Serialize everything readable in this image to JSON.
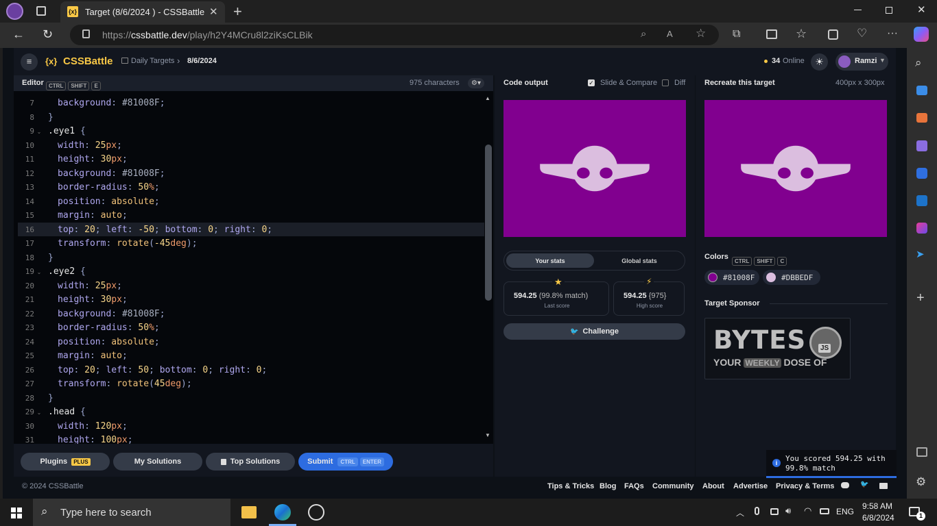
{
  "browser": {
    "tab_title": "Target (8/6/2024 ) - CSSBattle",
    "url_prefix": "https://",
    "url_domain": "cssbattle.dev",
    "url_path": "/play/h2Y4MCru8l2ziKsCLBik"
  },
  "app": {
    "brand": "CSSBattle",
    "brand_glyph": "{x}",
    "breadcrumb_parent": "Daily Targets",
    "breadcrumb_current": "8/6/2024",
    "online": "34",
    "online_label": "Online",
    "user": "Ramzi"
  },
  "editor": {
    "title": "Editor",
    "shortcut": [
      "CTRL",
      "SHIFT",
      "E"
    ],
    "characters": "975 characters",
    "lines": [
      {
        "n": "7",
        "indent": 2,
        "tokens": [
          [
            "prop",
            "background"
          ],
          [
            "plain",
            ": "
          ],
          [
            "hex",
            "#81008F"
          ],
          [
            "plain",
            ";"
          ]
        ]
      },
      {
        "n": "8",
        "indent": 1,
        "tokens": [
          [
            "plain",
            "}"
          ]
        ]
      },
      {
        "n": "9",
        "indent": 1,
        "fold": true,
        "tokens": [
          [
            "sel",
            ".eye1 "
          ],
          [
            "plain",
            "{"
          ]
        ]
      },
      {
        "n": "10",
        "indent": 2,
        "tokens": [
          [
            "prop",
            "width"
          ],
          [
            "plain",
            ": "
          ],
          [
            "num",
            "25"
          ],
          [
            "unit",
            "px"
          ],
          [
            "plain",
            ";"
          ]
        ]
      },
      {
        "n": "11",
        "indent": 2,
        "tokens": [
          [
            "prop",
            "height"
          ],
          [
            "plain",
            ": "
          ],
          [
            "num",
            "30"
          ],
          [
            "unit",
            "px"
          ],
          [
            "plain",
            ";"
          ]
        ]
      },
      {
        "n": "12",
        "indent": 2,
        "tokens": [
          [
            "prop",
            "background"
          ],
          [
            "plain",
            ": "
          ],
          [
            "hex",
            "#81008F"
          ],
          [
            "plain",
            ";"
          ]
        ]
      },
      {
        "n": "13",
        "indent": 2,
        "tokens": [
          [
            "prop",
            "border-radius"
          ],
          [
            "plain",
            ": "
          ],
          [
            "num",
            "50"
          ],
          [
            "unit",
            "%"
          ],
          [
            "plain",
            ";"
          ]
        ]
      },
      {
        "n": "14",
        "indent": 2,
        "tokens": [
          [
            "prop",
            "position"
          ],
          [
            "plain",
            ": "
          ],
          [
            "val",
            "absolute"
          ],
          [
            "plain",
            ";"
          ]
        ]
      },
      {
        "n": "15",
        "indent": 2,
        "tokens": [
          [
            "prop",
            "margin"
          ],
          [
            "plain",
            ": "
          ],
          [
            "val",
            "auto"
          ],
          [
            "plain",
            ";"
          ]
        ]
      },
      {
        "n": "16",
        "indent": 2,
        "hl": true,
        "tokens": [
          [
            "prop",
            "top"
          ],
          [
            "plain",
            ": "
          ],
          [
            "num",
            "20"
          ],
          [
            "plain",
            "; "
          ],
          [
            "prop",
            "left"
          ],
          [
            "plain",
            ": "
          ],
          [
            "num",
            "-50"
          ],
          [
            "plain",
            "; "
          ],
          [
            "prop",
            "bottom"
          ],
          [
            "plain",
            ": "
          ],
          [
            "num",
            "0"
          ],
          [
            "plain",
            "; "
          ],
          [
            "prop",
            "right"
          ],
          [
            "plain",
            ": "
          ],
          [
            "num",
            "0"
          ],
          [
            "plain",
            ";"
          ]
        ]
      },
      {
        "n": "17",
        "indent": 2,
        "tokens": [
          [
            "prop",
            "transform"
          ],
          [
            "plain",
            ": "
          ],
          [
            "fn",
            "rotate"
          ],
          [
            "plain",
            "("
          ],
          [
            "num",
            "-45"
          ],
          [
            "unit",
            "deg"
          ],
          [
            "plain",
            ");"
          ]
        ]
      },
      {
        "n": "18",
        "indent": 1,
        "tokens": [
          [
            "plain",
            "}"
          ]
        ]
      },
      {
        "n": "19",
        "indent": 1,
        "fold": true,
        "tokens": [
          [
            "sel",
            ".eye2 "
          ],
          [
            "plain",
            "{"
          ]
        ]
      },
      {
        "n": "20",
        "indent": 2,
        "tokens": [
          [
            "prop",
            "width"
          ],
          [
            "plain",
            ": "
          ],
          [
            "num",
            "25"
          ],
          [
            "unit",
            "px"
          ],
          [
            "plain",
            ";"
          ]
        ]
      },
      {
        "n": "21",
        "indent": 2,
        "tokens": [
          [
            "prop",
            "height"
          ],
          [
            "plain",
            ": "
          ],
          [
            "num",
            "30"
          ],
          [
            "unit",
            "px"
          ],
          [
            "plain",
            ";"
          ]
        ]
      },
      {
        "n": "22",
        "indent": 2,
        "tokens": [
          [
            "prop",
            "background"
          ],
          [
            "plain",
            ": "
          ],
          [
            "hex",
            "#81008F"
          ],
          [
            "plain",
            ";"
          ]
        ]
      },
      {
        "n": "23",
        "indent": 2,
        "tokens": [
          [
            "prop",
            "border-radius"
          ],
          [
            "plain",
            ": "
          ],
          [
            "num",
            "50"
          ],
          [
            "unit",
            "%"
          ],
          [
            "plain",
            ";"
          ]
        ]
      },
      {
        "n": "24",
        "indent": 2,
        "tokens": [
          [
            "prop",
            "position"
          ],
          [
            "plain",
            ": "
          ],
          [
            "val",
            "absolute"
          ],
          [
            "plain",
            ";"
          ]
        ]
      },
      {
        "n": "25",
        "indent": 2,
        "tokens": [
          [
            "prop",
            "margin"
          ],
          [
            "plain",
            ": "
          ],
          [
            "val",
            "auto"
          ],
          [
            "plain",
            ";"
          ]
        ]
      },
      {
        "n": "26",
        "indent": 2,
        "tokens": [
          [
            "prop",
            "top"
          ],
          [
            "plain",
            ": "
          ],
          [
            "num",
            "20"
          ],
          [
            "plain",
            "; "
          ],
          [
            "prop",
            "left"
          ],
          [
            "plain",
            ": "
          ],
          [
            "num",
            "50"
          ],
          [
            "plain",
            "; "
          ],
          [
            "prop",
            "bottom"
          ],
          [
            "plain",
            ": "
          ],
          [
            "num",
            "0"
          ],
          [
            "plain",
            "; "
          ],
          [
            "prop",
            "right"
          ],
          [
            "plain",
            ": "
          ],
          [
            "num",
            "0"
          ],
          [
            "plain",
            ";"
          ]
        ]
      },
      {
        "n": "27",
        "indent": 2,
        "tokens": [
          [
            "prop",
            "transform"
          ],
          [
            "plain",
            ": "
          ],
          [
            "fn",
            "rotate"
          ],
          [
            "plain",
            "("
          ],
          [
            "num",
            "45"
          ],
          [
            "unit",
            "deg"
          ],
          [
            "plain",
            ");"
          ]
        ]
      },
      {
        "n": "28",
        "indent": 1,
        "tokens": [
          [
            "plain",
            "}"
          ]
        ]
      },
      {
        "n": "29",
        "indent": 1,
        "fold": true,
        "tokens": [
          [
            "sel",
            ".head "
          ],
          [
            "plain",
            "{"
          ]
        ]
      },
      {
        "n": "30",
        "indent": 2,
        "tokens": [
          [
            "prop",
            "width"
          ],
          [
            "plain",
            ": "
          ],
          [
            "num",
            "120"
          ],
          [
            "unit",
            "px"
          ],
          [
            "plain",
            ";"
          ]
        ]
      },
      {
        "n": "31",
        "indent": 2,
        "tokens": [
          [
            "prop",
            "height"
          ],
          [
            "plain",
            ": "
          ],
          [
            "num",
            "100"
          ],
          [
            "unit",
            "px"
          ],
          [
            "plain",
            ";"
          ]
        ]
      }
    ],
    "buttons": {
      "plugins": "Plugins",
      "plus": "PLUS",
      "my_solutions": "My Solutions",
      "top_solutions": "Top Solutions",
      "submit": "Submit",
      "submit_keys": [
        "CTRL",
        "ENTER"
      ]
    }
  },
  "output": {
    "title": "Code output",
    "slide_compare": "Slide & Compare",
    "diff": "Diff",
    "stats_tabs": [
      "Your stats",
      "Global stats"
    ],
    "last_score": "594.25",
    "last_match": "(99.8% match)",
    "last_label": "Last score",
    "high_score": "594.25",
    "high_chars": "{975}",
    "high_label": "High score",
    "challenge": "Challenge"
  },
  "target": {
    "title": "Recreate this target",
    "size": "400px x 300px",
    "colors_label": "Colors",
    "colors_keys": [
      "CTRL",
      "SHIFT",
      "C"
    ],
    "colors": [
      "#81008F",
      "#DBBEDF"
    ],
    "sponsor_label": "Target Sponsor",
    "sponsor_big": "BYTES",
    "sponsor_small_a": "YOUR",
    "sponsor_small_b": "WEEKLY",
    "sponsor_small_c": "DOSE OF",
    "sponsor_js": "JS"
  },
  "toast": {
    "line1": "You scored 594.25 with",
    "line2": "99.8% match"
  },
  "footer": {
    "copyright": "© 2024 CSSBattle",
    "links": [
      "Tips & Tricks",
      "Blog",
      "FAQs",
      "Community",
      "About",
      "Advertise",
      "Privacy & Terms"
    ]
  },
  "taskbar": {
    "search": "Type here to search",
    "lang": "ENG",
    "time": "9:58 AM",
    "date": "6/8/2024",
    "notif": "1"
  },
  "theme": {
    "purple": "#81008F",
    "lilac": "#DBBEDF",
    "accent": "#f9c846",
    "blue": "#2d6ce0"
  }
}
